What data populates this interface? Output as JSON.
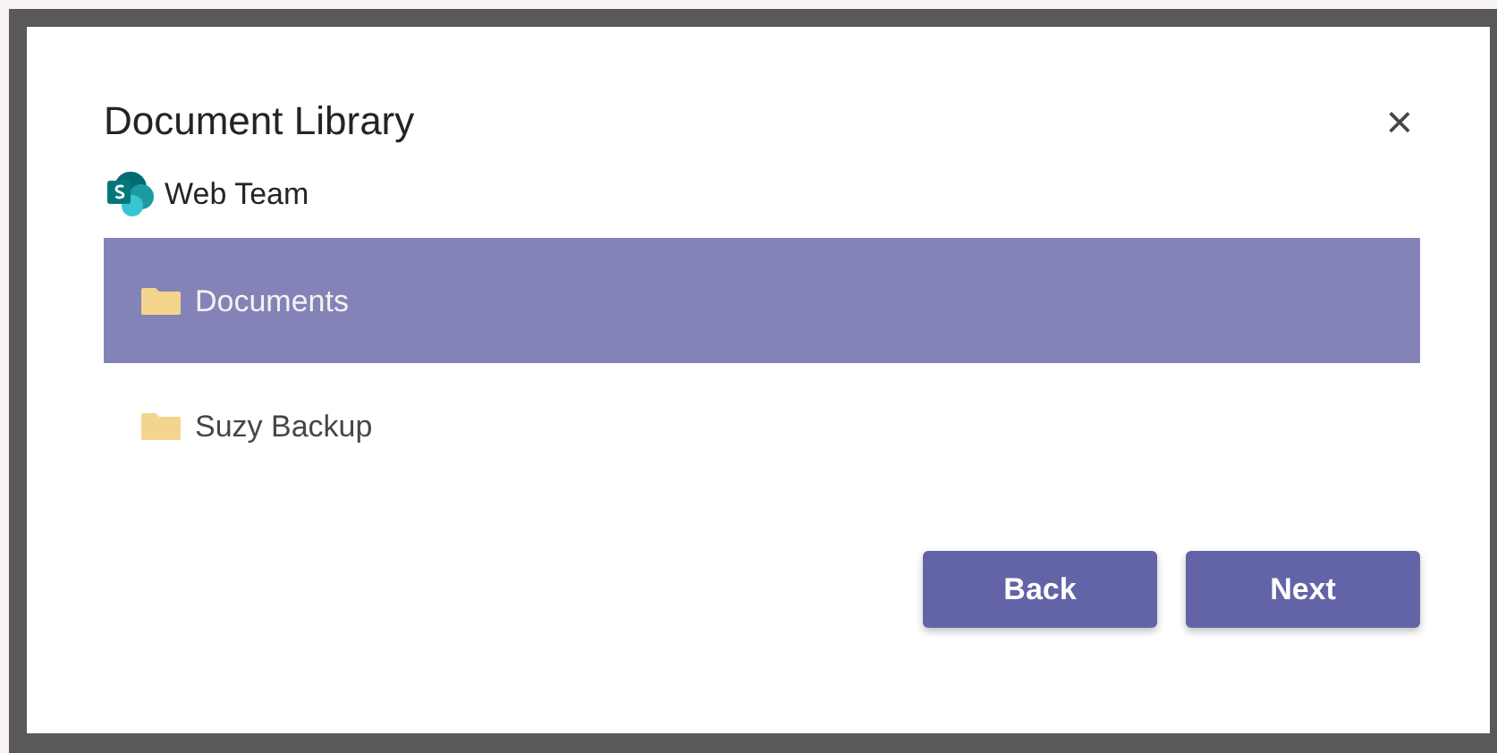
{
  "dialog": {
    "title": "Document Library",
    "close": "×"
  },
  "site": {
    "name": "Web Team"
  },
  "libraries": [
    {
      "name": "Documents",
      "selected": true
    },
    {
      "name": "Suzy Backup",
      "selected": false
    }
  ],
  "buttons": [
    "Back",
    "Next"
  ]
}
